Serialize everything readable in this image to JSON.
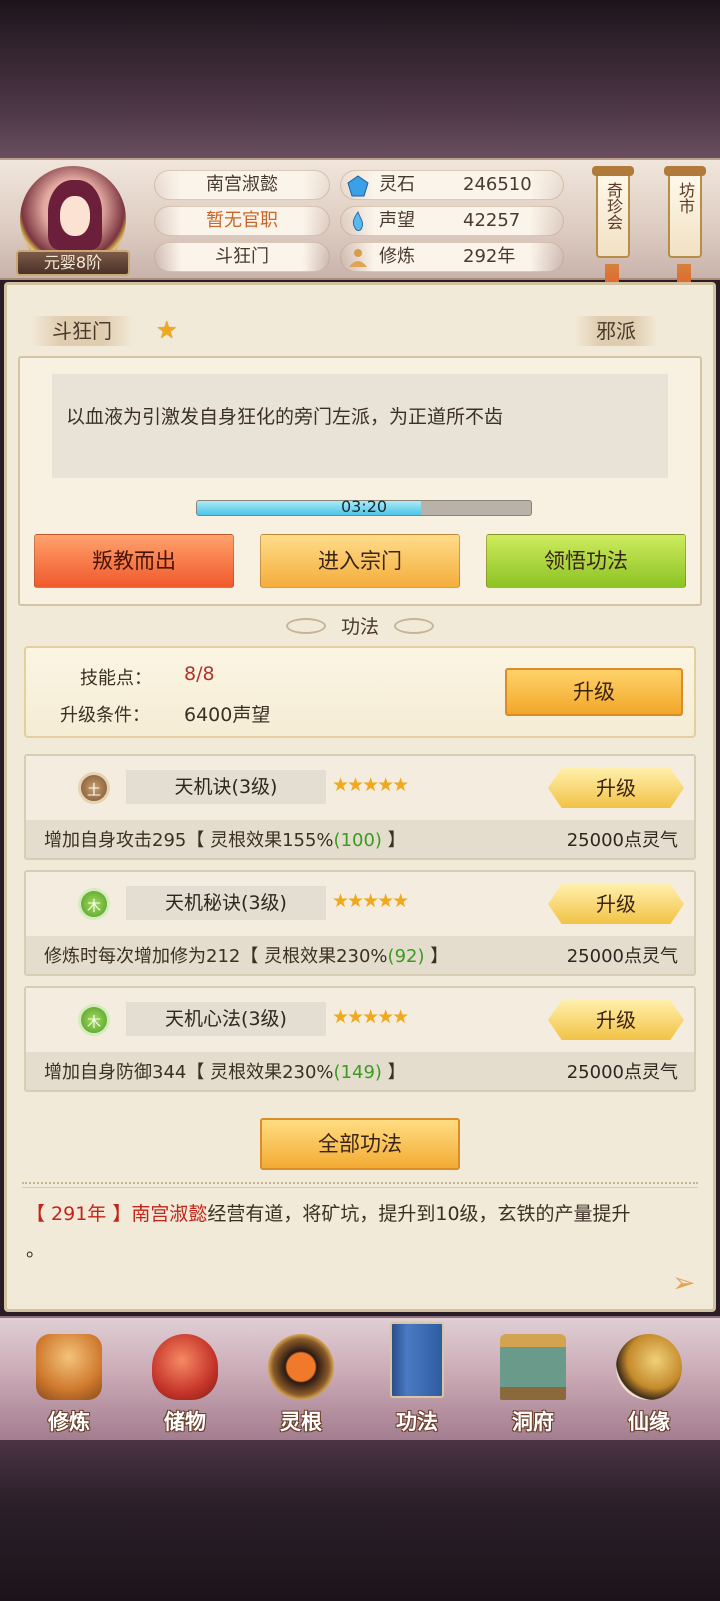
{
  "profile": {
    "rank": "元婴8阶",
    "name": "南宫淑懿",
    "official_title": "暂无官职",
    "sect": "斗狂门"
  },
  "resources": [
    {
      "label": "灵石",
      "value": "246510",
      "icon": "spirit-stone-icon"
    },
    {
      "label": "声望",
      "value": "42257",
      "icon": "reputation-icon"
    },
    {
      "label": "修炼",
      "value": "292年",
      "icon": "cultivation-icon"
    }
  ],
  "side_banners": {
    "treasure": "奇珍会",
    "market": "坊市"
  },
  "sect_panel": {
    "sect_name": "斗狂门",
    "alignment": "邪派",
    "description": "以血液为引激发自身狂化的旁门左派，为正道所不齿",
    "timer": "03:20",
    "timer_progress": 0.67,
    "buttons": {
      "betray": "叛教而出",
      "enter": "进入宗门",
      "comprehend": "领悟功法"
    }
  },
  "skills_section": {
    "title": "功法",
    "skill_points_label": "技能点：",
    "skill_points_value": "8/8",
    "upgrade_condition_label": "升级条件：",
    "upgrade_condition_value": "6400声望",
    "upgrade_label": "升级",
    "skills": [
      {
        "element": "土",
        "name": "天机诀(3级)",
        "stars": "★★★★★",
        "upgrade": "升级",
        "desc_prefix": "增加自身攻击295【 灵根效果155%",
        "desc_green": "(100)",
        "desc_suffix": " 】",
        "cost": "25000点灵气"
      },
      {
        "element": "木",
        "name": "天机秘诀(3级)",
        "stars": "★★★★★",
        "upgrade": "升级",
        "desc_prefix": "修炼时每次增加修为212【 灵根效果230%",
        "desc_green": "(92)",
        "desc_suffix": " 】",
        "cost": "25000点灵气"
      },
      {
        "element": "木",
        "name": "天机心法(3级)",
        "stars": "★★★★★",
        "upgrade": "升级",
        "desc_prefix": "增加自身防御344【 灵根效果230%",
        "desc_green": "(149)",
        "desc_suffix": " 】",
        "cost": "25000点灵气"
      }
    ],
    "all_skills_button": "全部功法"
  },
  "log": {
    "year": "【 291年 】",
    "name": "南宫淑懿",
    "text": "经营有道，将矿坑，提升到10级，玄铁的产量提升",
    "text_end": "。"
  },
  "nav": [
    {
      "label": "修炼",
      "icon": "cultivate-icon"
    },
    {
      "label": "储物",
      "icon": "storage-bag-icon"
    },
    {
      "label": "灵根",
      "icon": "spirit-root-icon"
    },
    {
      "label": "功法",
      "icon": "skill-book-icon"
    },
    {
      "label": "洞府",
      "icon": "cave-dwelling-icon"
    },
    {
      "label": "仙缘",
      "icon": "immortal-fate-icon"
    }
  ],
  "colors": {
    "accent_red": "#c2241a",
    "accent_green": "#3c9a22",
    "official_title_color": "#c9662a",
    "star_gold": "#f0a81c"
  }
}
